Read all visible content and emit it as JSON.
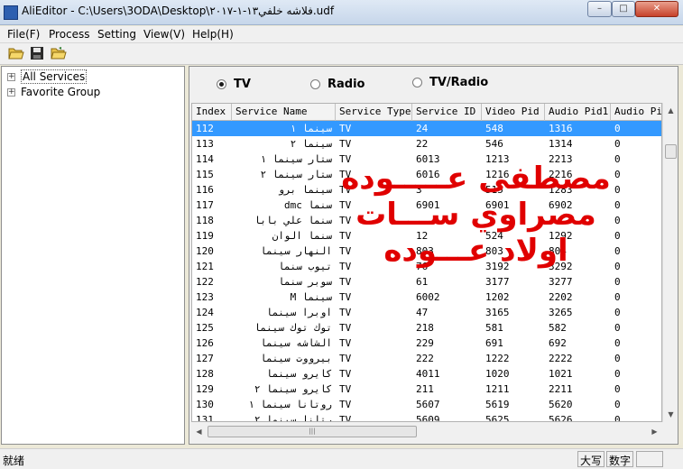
{
  "window": {
    "title": "AliEditor - C:\\Users\\3ODA\\Desktop\\فلاشه خلفي١٣-١-٢٠١٧.udf",
    "min_label": "–",
    "max_label": "□",
    "close_label": "✕"
  },
  "menu": {
    "file": "File(F)",
    "process": "Process",
    "setting": "Setting",
    "view": "View(V)",
    "help": "Help(H)"
  },
  "toolbar": {
    "open_icon": "folder-open-icon",
    "save_icon": "save-icon",
    "open2_icon": "folder-open-icon"
  },
  "tree": {
    "items": [
      {
        "label": "All Services",
        "expander": "+"
      },
      {
        "label": "Favorite Group",
        "expander": "+"
      }
    ]
  },
  "filter": {
    "tv": "TV",
    "radio": "Radio",
    "tvradio": "TV/Radio",
    "selected": "TV"
  },
  "table": {
    "columns": [
      "Index",
      "Service Name",
      "Service Type",
      "Service ID",
      "Video Pid",
      "Audio Pid1",
      "Audio Pid"
    ],
    "rows": [
      [
        "112",
        "سينما ١",
        "TV",
        "24",
        "548",
        "1316",
        "0"
      ],
      [
        "113",
        "سينما ٢",
        "TV",
        "22",
        "546",
        "1314",
        "0"
      ],
      [
        "114",
        "ستار سينما ١",
        "TV",
        "6013",
        "1213",
        "2213",
        "0"
      ],
      [
        "115",
        "ستار سينما ٢",
        "TV",
        "6016",
        "1216",
        "2216",
        "0"
      ],
      [
        "116",
        "سينما برو",
        "TV",
        "3",
        "515",
        "1283",
        "0"
      ],
      [
        "117",
        "سنما dmc",
        "TV",
        "6901",
        "6901",
        "6902",
        "0"
      ],
      [
        "118",
        "سنما علي بابا",
        "TV",
        "",
        "",
        "",
        "0"
      ],
      [
        "119",
        "سنما الوان",
        "TV",
        "12",
        "524",
        "1292",
        "0"
      ],
      [
        "120",
        "النهار سينما",
        "TV",
        "803",
        "803",
        "804",
        "0"
      ],
      [
        "121",
        "تيوب سنما",
        "TV",
        "76",
        "3192",
        "3292",
        "0"
      ],
      [
        "122",
        "سوبر سنما",
        "TV",
        "61",
        "3177",
        "3277",
        "0"
      ],
      [
        "123",
        "سينما M",
        "TV",
        "6002",
        "1202",
        "2202",
        "0"
      ],
      [
        "124",
        "اوبرا سينما",
        "TV",
        "47",
        "3165",
        "3265",
        "0"
      ],
      [
        "125",
        "توك توك سينما",
        "TV",
        "218",
        "581",
        "582",
        "0"
      ],
      [
        "126",
        "الشاشه سينما",
        "TV",
        "229",
        "691",
        "692",
        "0"
      ],
      [
        "127",
        "بيرووت سينما",
        "TV",
        "222",
        "1222",
        "2222",
        "0"
      ],
      [
        "128",
        "كايرو سينما",
        "TV",
        "4011",
        "1020",
        "1021",
        "0"
      ],
      [
        "129",
        "كايرو سينما ٢",
        "TV",
        "211",
        "1211",
        "2211",
        "0"
      ],
      [
        "130",
        "روتانا سينما ١",
        "TV",
        "5607",
        "5619",
        "5620",
        "0"
      ],
      [
        "131",
        "رتانا سينما ٢",
        "TV",
        "5609",
        "5625",
        "5626",
        "0"
      ]
    ],
    "selected_index": "112"
  },
  "overlay": {
    "line1": "مصطفى عـــــوده",
    "line2": "مصراوي ســـات",
    "line3": "اولاد عـــوده",
    "color": "#e00000"
  },
  "scroll": {
    "up": "▲",
    "down": "▼",
    "left": "◀",
    "right": "▶",
    "grip": "|||"
  },
  "status": {
    "text": "就绪",
    "caps": "大写",
    "num": "数字"
  }
}
